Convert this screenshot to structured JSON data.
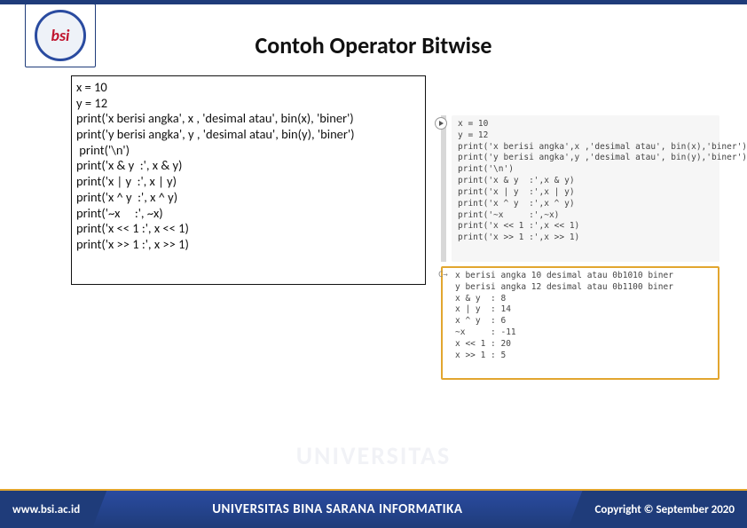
{
  "header": {
    "title": "Contoh Operator Bitwise",
    "logo_initials": "bsi"
  },
  "code_box": {
    "lines": [
      "x = 10",
      "y = 12",
      "print('x berisi angka', x , 'desimal atau', bin(x), 'biner')",
      "print('y berisi angka', y , 'desimal atau', bin(y), 'biner')",
      " print('\\n')",
      "print('x & y  :', x & y)",
      "print('x | y  :', x | y)",
      "print('x ^ y  :', x ^ y)",
      "print('~x     :', ~x)",
      "print('x << 1 :', x << 1)",
      "print('x >> 1 :', x >> 1)"
    ]
  },
  "nb_input": {
    "lines": [
      "x = 10",
      "y = 12",
      "print('x berisi angka',x ,'desimal atau', bin(x),'biner')",
      "print('y berisi angka',y ,'desimal atau', bin(y),'biner')",
      "print('\\n')",
      "print('x & y  :',x & y)",
      "print('x | y  :',x | y)",
      "print('x ^ y  :',x ^ y)",
      "print('~x     :',~x)",
      "print('x << 1 :',x << 1)",
      "print('x >> 1 :',x >> 1)"
    ]
  },
  "nb_output": {
    "marker": "C→",
    "lines": [
      "x berisi angka 10 desimal atau 0b1010 biner",
      "y berisi angka 12 desimal atau 0b1100 biner",
      "",
      "",
      "x & y  : 8",
      "x | y  : 14",
      "x ^ y  : 6",
      "~x     : -11",
      "x << 1 : 20",
      "x >> 1 : 5"
    ]
  },
  "footer": {
    "left": "www.bsi.ac.id",
    "center": "UNIVERSITAS BINA SARANA INFORMATIKA",
    "right": "Copyright © September 2020"
  },
  "watermark": "UNIVERSITAS"
}
